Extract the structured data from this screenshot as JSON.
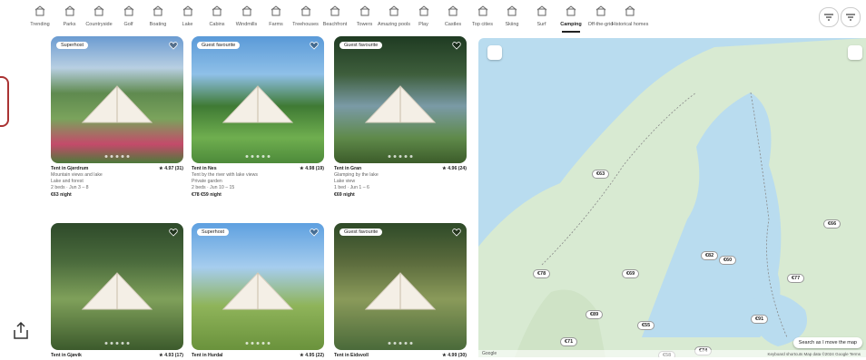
{
  "categories": [
    {
      "label": "Trending",
      "icon": "trending-icon"
    },
    {
      "label": "Parks",
      "icon": "tree-icon"
    },
    {
      "label": "Countryside",
      "icon": "barn-icon"
    },
    {
      "label": "Golf",
      "icon": "golf-icon"
    },
    {
      "label": "Boating",
      "icon": "boat-icon"
    },
    {
      "label": "Lake",
      "icon": "lake-icon"
    },
    {
      "label": "Cabins",
      "icon": "cabin-icon"
    },
    {
      "label": "Windmills",
      "icon": "windmill-icon"
    },
    {
      "label": "Farms",
      "icon": "farm-icon"
    },
    {
      "label": "Treehouses",
      "icon": "treehouse-icon"
    },
    {
      "label": "Beachfront",
      "icon": "beach-icon"
    },
    {
      "label": "Towers",
      "icon": "tower-icon"
    },
    {
      "label": "Amazing pools",
      "icon": "pool-icon"
    },
    {
      "label": "Play",
      "icon": "play-icon"
    },
    {
      "label": "Castles",
      "icon": "castle-icon"
    },
    {
      "label": "Top cities",
      "icon": "city-icon"
    },
    {
      "label": "Skiing",
      "icon": "ski-icon"
    },
    {
      "label": "Surf",
      "icon": "surf-icon"
    },
    {
      "label": "Camping",
      "icon": "tent-icon"
    },
    {
      "label": "Off-the-grid",
      "icon": "compass-icon"
    },
    {
      "label": "Historical homes",
      "icon": "house-icon"
    }
  ],
  "active_category": "Camping",
  "filter_button": "filter-icon",
  "listings": [
    {
      "badge": "Superhost",
      "title": "Tent in Gjerdrum",
      "rating": "★ 4.97 (31)",
      "line1": "Mountain views and lake",
      "line2": "Lake and forest",
      "line3": "2 beds · Jun 3 – 8",
      "price": "€63 night"
    },
    {
      "badge": "Guest favourite",
      "title": "Tent in Nes",
      "rating": "★ 4.98 (19)",
      "line1": "Tent by the river with lake views",
      "line2": "Private garden",
      "line3": "2 beds · Jun 10 – 15",
      "price": "€78 €59 night"
    },
    {
      "badge": "Guest favourite",
      "title": "Tent in Gran",
      "rating": "★ 4.96 (24)",
      "line1": "Glamping by the lake",
      "line2": "Lake view",
      "line3": "1 bed · Jun 1 – 6",
      "price": "€69 night"
    },
    {
      "badge": "",
      "title": "Tent in Gjøvik",
      "rating": "★ 4.93 (17)",
      "line1": "",
      "line2": "",
      "line3": "",
      "price": ""
    },
    {
      "badge": "Superhost",
      "title": "Tent in Hurdal",
      "rating": "★ 4.95 (22)",
      "line1": "",
      "line2": "",
      "line3": "",
      "price": ""
    },
    {
      "badge": "Guest favourite",
      "title": "Tent in Eidsvoll",
      "rating": "★ 4.99 (30)",
      "line1": "",
      "line2": "",
      "line3": "",
      "price": ""
    }
  ],
  "map": {
    "price_pins": [
      "€63",
      "€78",
      "€69",
      "€89",
      "€71",
      "€55",
      "€82",
      "€60",
      "€74",
      "€91",
      "€58",
      "€66",
      "€77"
    ],
    "toggle_label": "Search as I move the map",
    "attribution": "Keyboard shortcuts  Map data ©2024 Google  Terms",
    "google_label": "Google"
  },
  "colors": {
    "map_water": "#b9dcef",
    "map_land": "#d8ead2",
    "accent": "#a33333"
  }
}
